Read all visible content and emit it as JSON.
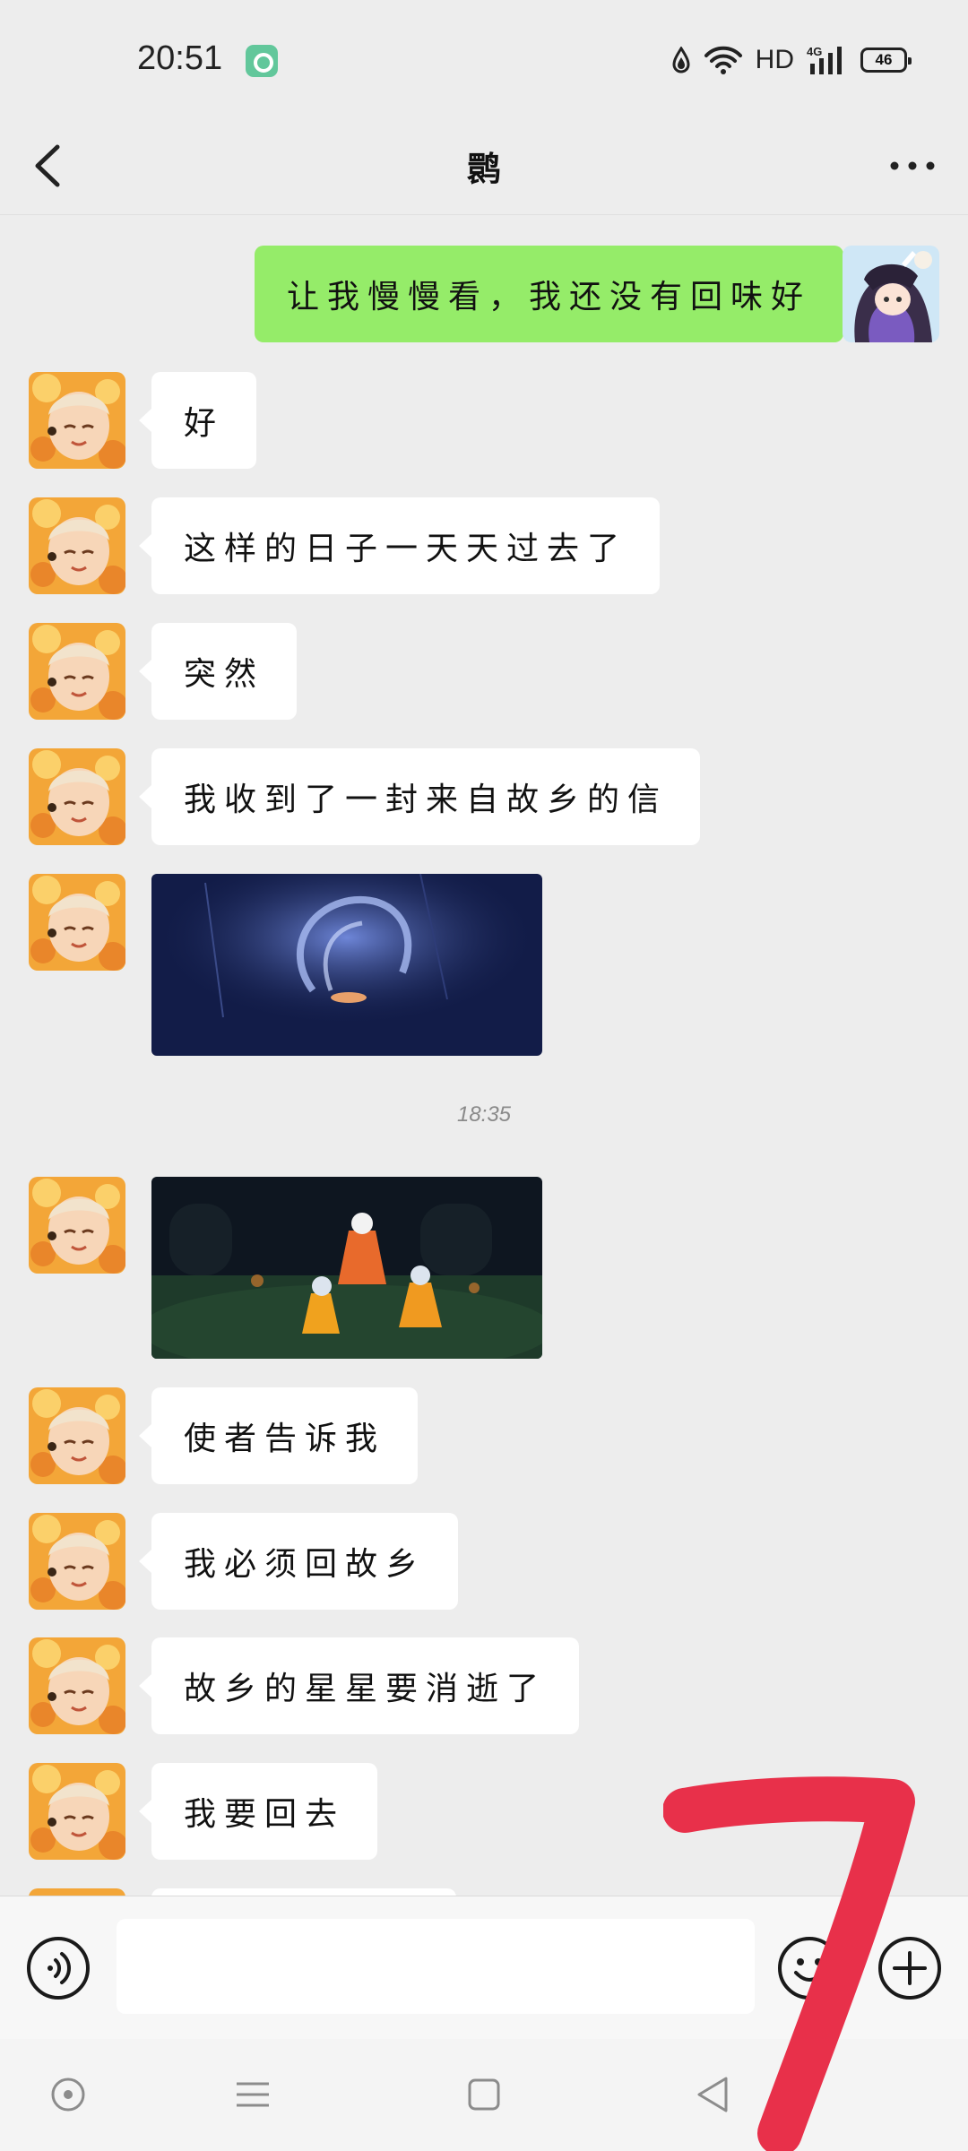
{
  "status_bar": {
    "time": "20:51",
    "network_label": "HD",
    "signal_label": "4G",
    "battery_level": "46",
    "app_badge_color": "#62C79B"
  },
  "header": {
    "back_icon": "chevron-left-icon",
    "title": "鹮",
    "more_icon": "more-horizontal-icon"
  },
  "messages": [
    {
      "side": "right",
      "type": "text",
      "text": "让我慢慢看，我还没有回味好"
    },
    {
      "side": "left",
      "type": "text",
      "text": "好"
    },
    {
      "side": "left",
      "type": "text",
      "text": "这样的日子一天天过去了"
    },
    {
      "side": "left",
      "type": "text",
      "text": "突然"
    },
    {
      "side": "left",
      "type": "text",
      "text": "我收到了一封来自故乡的信"
    },
    {
      "side": "left",
      "type": "image",
      "subject": "glowing-spirit-night"
    },
    {
      "type": "time",
      "text": "18:35"
    },
    {
      "side": "left",
      "type": "image",
      "subject": "caped-children-meadow"
    },
    {
      "side": "left",
      "type": "text",
      "text": "使者告诉我"
    },
    {
      "side": "left",
      "type": "text",
      "text": "我必须回故乡"
    },
    {
      "side": "left",
      "type": "text",
      "text": "故乡的星星要消逝了"
    },
    {
      "side": "left",
      "type": "text",
      "text": "我要回去"
    }
  ],
  "input_bar": {
    "voice_icon": "voice-icon",
    "input_value": "",
    "emoji_icon": "emoji-icon",
    "plus_icon": "plus-circle-icon"
  },
  "nav_bar": {
    "icons": [
      "assistant-dot-icon",
      "menu-icon",
      "home-square-icon",
      "back-triangle-icon"
    ]
  },
  "colors": {
    "background": "#EDEDED",
    "outgoing_bubble": "#95EC69",
    "incoming_bubble": "#FFFFFF",
    "overlay_mark": "#E8304A"
  }
}
